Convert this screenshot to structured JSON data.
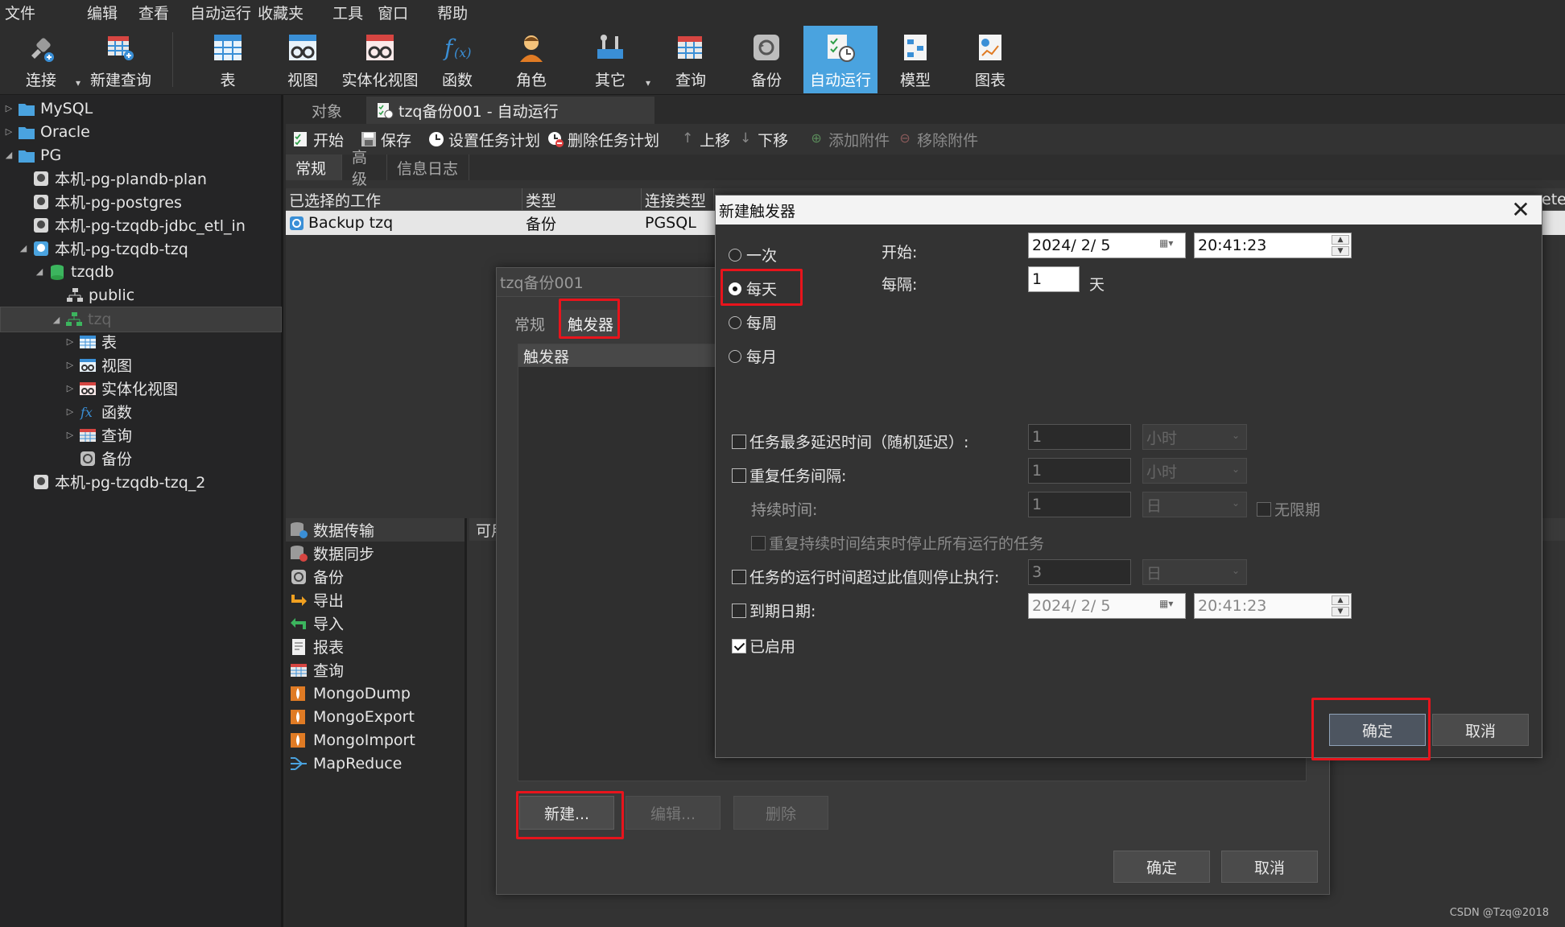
{
  "menu": [
    "文件",
    "编辑",
    "查看",
    "自动运行",
    "收藏夹",
    "工具",
    "窗口",
    "帮助"
  ],
  "toolbar": {
    "connect": "连接",
    "new_query": "新建查询",
    "table": "表",
    "view": "视图",
    "mat_view": "实体化视图",
    "function": "函数",
    "role": "角色",
    "other": "其它",
    "query": "查询",
    "backup": "备份",
    "automation": "自动运行",
    "model": "模型",
    "chart": "图表"
  },
  "tree": {
    "mysql": "MySQL",
    "oracle": "Oracle",
    "pg": "PG",
    "conn1": "本机-pg-plandb-plan",
    "conn2": "本机-pg-postgres",
    "conn3": "本机-pg-tzqdb-jdbc_etl_in",
    "conn4": "本机-pg-tzqdb-tzq",
    "db": "tzqdb",
    "schema_public": "public",
    "schema_tzq": "tzq",
    "n_table": "表",
    "n_view": "视图",
    "n_matview": "实体化视图",
    "n_function": "函数",
    "n_query": "查询",
    "n_backup": "备份",
    "conn5": "本机-pg-tzqdb-tzq_2"
  },
  "main": {
    "tab_objects": "对象",
    "tab_active": "tzq备份001 - 自动运行",
    "actions": {
      "start": "开始",
      "save": "保存",
      "set_schedule": "设置任务计划",
      "delete_schedule": "删除任务计划",
      "move_up": "上移",
      "move_down": "下移",
      "add_attach": "添加附件",
      "remove_attach": "移除附件"
    },
    "subtabs": [
      "常规",
      "高级",
      "信息日志"
    ],
    "grid_headers": [
      "已选择的工作",
      "类型",
      "连接类型"
    ],
    "grid_tail": "eter",
    "grid_row": [
      "Backup tzq",
      "备份",
      "PGSQL"
    ],
    "lower_items": [
      "数据传输",
      "数据同步",
      "备份",
      "导出",
      "导入",
      "报表",
      "查询",
      "MongoDump",
      "MongoExport",
      "MongoImport",
      "MapReduce"
    ],
    "lower_right_head": "可用"
  },
  "job_dialog": {
    "title": "tzq备份001",
    "tabs": [
      "常规",
      "触发器"
    ],
    "panel_head": "触发器",
    "new_btn": "新建...",
    "edit_btn": "编辑...",
    "delete_btn": "删除",
    "ok": "确定",
    "cancel": "取消"
  },
  "trigger_dialog": {
    "title": "新建触发器",
    "close": "✕",
    "freq": [
      "一次",
      "每天",
      "每周",
      "每月"
    ],
    "selected_freq": "每天",
    "start_label": "开始:",
    "start_date": "2024/  2/  5",
    "start_time": "20:41:23",
    "interval_label": "每隔:",
    "interval_value": "1",
    "interval_unit": "天",
    "delay_label": "任务最多延迟时间（随机延迟）:",
    "delay_value": "1",
    "delay_unit": "小时",
    "repeat_label": "重复任务间隔:",
    "repeat_value": "1",
    "repeat_unit": "小时",
    "duration_label": "持续时间:",
    "duration_value": "1",
    "duration_unit": "日",
    "indefinite_label": "无限期",
    "stop_at_end_label": "重复持续时间结束时停止所有运行的任务",
    "stop_long_label": "任务的运行时间超过此值则停止执行:",
    "stop_long_value": "3",
    "stop_long_unit": "日",
    "expire_label": "到期日期:",
    "expire_date": "2024/  2/  5",
    "expire_time": "20:41:23",
    "enabled_label": "已启用",
    "ok": "确定",
    "cancel": "取消"
  },
  "watermark": "CSDN @Tzq@2018",
  "colors": {
    "accent": "#4aa3df",
    "highlight": "#e8141c"
  }
}
